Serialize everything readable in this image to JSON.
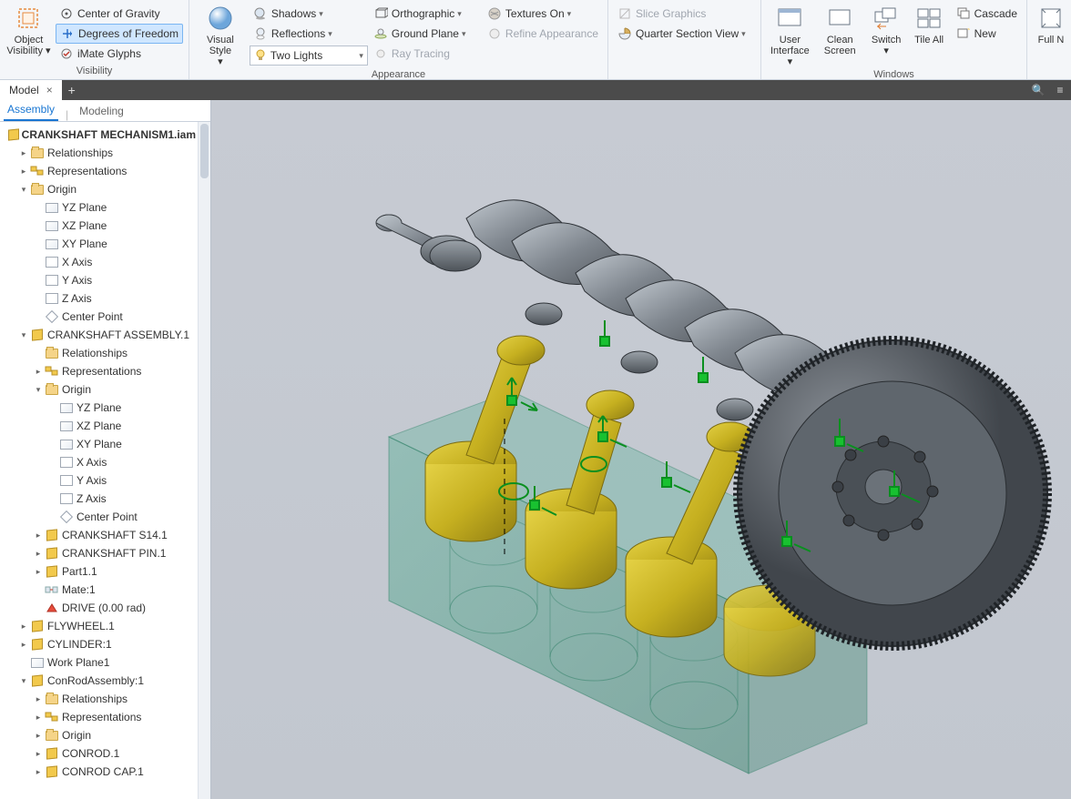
{
  "ribbon": {
    "visibility": {
      "object_visibility": "Object\nVisibility",
      "center_gravity": "Center of Gravity",
      "dof": "Degrees of Freedom",
      "imate": "iMate Glyphs",
      "label": "Visibility"
    },
    "appearance": {
      "visual_style": "Visual Style",
      "shadows": "Shadows",
      "reflections": "Reflections",
      "lights_value": "Two Lights",
      "orthographic": "Orthographic",
      "ground_plane": "Ground Plane",
      "ray_tracing": "Ray Tracing",
      "textures_on": "Textures On",
      "refine": "Refine Appearance",
      "label": "Appearance"
    },
    "section": {
      "slice": "Slice Graphics",
      "quarter": "Quarter Section View"
    },
    "windows": {
      "user_interface": "User\nInterface",
      "clean_screen": "Clean\nScreen",
      "switch": "Switch",
      "tile_all": "Tile All",
      "cascade": "Cascade",
      "new": "New",
      "label": "Windows"
    },
    "full": "Full N"
  },
  "panel": {
    "model": "Model"
  },
  "browser_tabs": {
    "assembly": "Assembly",
    "modeling": "Modeling"
  },
  "tree": {
    "root": "CRANKSHAFT MECHANISM1.iam",
    "relationships": "Relationships",
    "representations": "Representations",
    "origin": "Origin",
    "yz": "YZ Plane",
    "xz": "XZ Plane",
    "xy": "XY Plane",
    "xaxis": "X Axis",
    "yaxis": "Y Axis",
    "zaxis": "Z Axis",
    "center": "Center Point",
    "asm": "CRANKSHAFT ASSEMBLY.1",
    "s14": "CRANKSHAFT S14.1",
    "pin": "CRANKSHAFT PIN.1",
    "part1": "Part1.1",
    "mate": "Mate:1",
    "drive": "DRIVE (0.00 rad)",
    "flywheel": "FLYWHEEL.1",
    "cylinder": "CYLINDER:1",
    "workplane": "Work Plane1",
    "conrod_asm": "ConRodAssembly:1",
    "conrod": "CONROD.1",
    "conrod_cap": "CONROD CAP.1"
  }
}
